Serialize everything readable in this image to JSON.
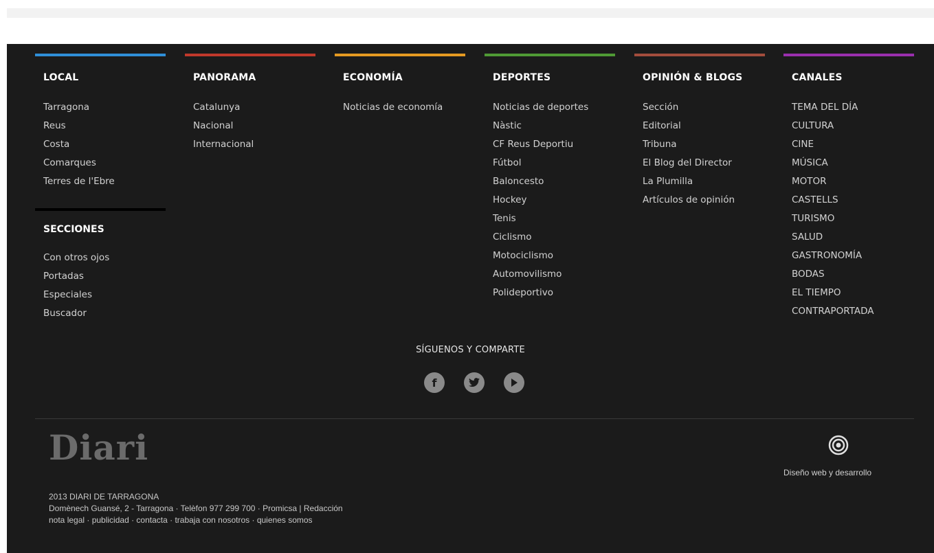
{
  "columns": [
    {
      "heading": "LOCAL",
      "color": "#2f8fd8",
      "items": [
        "Tarragona",
        "Reus",
        "Costa",
        "Comarques",
        "Terres de l'Ebre"
      ]
    },
    {
      "heading": "PANORAMA",
      "color": "#c0392b",
      "items": [
        "Catalunya",
        "Nacional",
        "Internacional"
      ]
    },
    {
      "heading": "ECONOMÍA",
      "color": "#e59a22",
      "items": [
        "Noticias de economía"
      ]
    },
    {
      "heading": "DEPORTES",
      "color": "#4f9a35",
      "items": [
        "Noticias de deportes",
        "Nàstic",
        "CF Reus Deportiu",
        "Fútbol",
        "Baloncesto",
        "Hockey",
        "Tenis",
        "Ciclismo",
        "Motociclismo",
        "Automovilismo",
        "Polideportivo"
      ]
    },
    {
      "heading": "OPINIÓN & BLOGS",
      "color": "#a34d3c",
      "items": [
        "Sección",
        "Editorial",
        "Tribuna",
        "El Blog del Director",
        "La Plumilla",
        "Artículos de opinión"
      ]
    },
    {
      "heading": "CANALES",
      "color": "#9a2fae",
      "items": [
        "TEMA DEL DÍA",
        "CULTURA",
        "CINE",
        "MÚSICA",
        "MOTOR",
        "CASTELLS",
        "TURISMO",
        "SALUD",
        "GASTRONOMÍA",
        "BODAS",
        "EL TIEMPO",
        "CONTRAPORTADA"
      ]
    }
  ],
  "secciones": {
    "heading": "SECCIONES",
    "items": [
      "Con otros ojos",
      "Portadas",
      "Especiales",
      "Buscador"
    ]
  },
  "follow": {
    "label": "SÍGUENOS Y COMPARTE",
    "icons": [
      "facebook-icon",
      "twitter-icon",
      "youtube-icon"
    ]
  },
  "brand": {
    "logo": "Diari",
    "copyright": "2013 DIARI DE TARRAGONA",
    "address": "Domènech Guansé, 2 - Tarragona · Telèfon 977 299 700 · Promicsa | Redacción",
    "links_line": "nota legal · publicidad · contacta · trabaja con nosotros · quienes somos"
  },
  "developer": {
    "label": "Diseño web y desarrollo",
    "icon": "concentric-circles-icon"
  }
}
